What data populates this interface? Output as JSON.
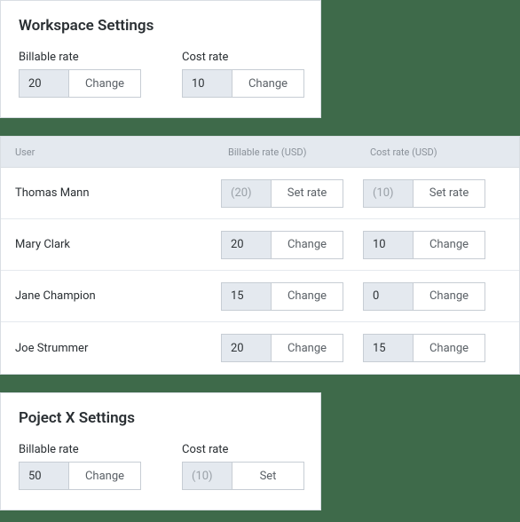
{
  "workspace": {
    "title": "Workspace Settings",
    "billable_label": "Billable rate",
    "billable_value": "20",
    "billable_btn": "Change",
    "cost_label": "Cost rate",
    "cost_value": "10",
    "cost_btn": "Change"
  },
  "table": {
    "header_user": "User",
    "header_billable": "Billable rate (USD)",
    "header_cost": "Cost rate (USD)",
    "rows": [
      {
        "name": "Thomas Mann",
        "bill_val": "(20)",
        "bill_btn": "Set rate",
        "bill_placeholder": true,
        "cost_val": "(10)",
        "cost_btn": "Set rate",
        "cost_placeholder": true
      },
      {
        "name": "Mary Clark",
        "bill_val": "20",
        "bill_btn": "Change",
        "bill_placeholder": false,
        "cost_val": "10",
        "cost_btn": "Change",
        "cost_placeholder": false
      },
      {
        "name": "Jane Champion",
        "bill_val": "15",
        "bill_btn": "Change",
        "bill_placeholder": false,
        "cost_val": "0",
        "cost_btn": "Change",
        "cost_placeholder": false
      },
      {
        "name": "Joe Strummer",
        "bill_val": "20",
        "bill_btn": "Change",
        "bill_placeholder": false,
        "cost_val": "15",
        "cost_btn": "Change",
        "cost_placeholder": false
      }
    ]
  },
  "project": {
    "title": "Poject X Settings",
    "billable_label": "Billable rate",
    "billable_value": "50",
    "billable_btn": "Change",
    "cost_label": "Cost rate",
    "cost_value": "(10)",
    "cost_placeholder": true,
    "cost_btn": "Set"
  }
}
